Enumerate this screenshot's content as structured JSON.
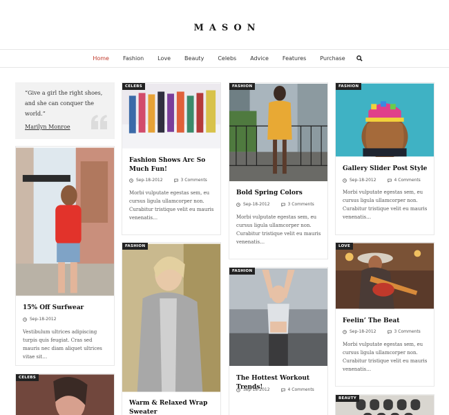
{
  "site": {
    "logo": "MASON"
  },
  "nav": {
    "items": [
      "Home",
      "Fashion",
      "Love",
      "Beauty",
      "Celebs",
      "Advice",
      "Features",
      "Purchase"
    ],
    "active": "Home"
  },
  "quote": {
    "text": "“Give a girl the right shoes, and she can conquer the world.”",
    "author": "Marilyn Monroe"
  },
  "posts": [
    {
      "title": "15% Off Surfwear",
      "date": "Sep-18-2012",
      "comments": "",
      "excerpt": "Vestibulum ultrices adipiscing turpis quis feugiat. Cras sed mauris nec diam aliquet ultrices vitae sit…",
      "tag": ""
    },
    {
      "title": "",
      "date": "",
      "comments": "",
      "excerpt": "",
      "tag": "CELEBS"
    },
    {
      "title": "Fashion Shows Arc So Much Fun!",
      "date": "Sep-18-2012",
      "comments": "3 Comments",
      "excerpt": "Morbi vulputate egestas sem, eu cursus ligula ullamcorper non. Curabitur tristique velit eu mauris venenatis…",
      "tag": "CELEBS"
    },
    {
      "title": "Warm & Relaxed Wrap Sweater",
      "date": "",
      "comments": "",
      "excerpt": "",
      "tag": "FASHION"
    },
    {
      "title": "Bold Spring Colors",
      "date": "Sep-18-2012",
      "comments": "3 Comments",
      "excerpt": "Morbi vulputate egestas sem, eu cursus ligula ullamcorper non. Curabitur tristique velit eu mauris venenatis…",
      "tag": "FASHION"
    },
    {
      "title": "The Hottest Workout Trends!",
      "date": "Sep-18-2012",
      "comments": "4 Comments",
      "excerpt": "",
      "tag": "FASHION"
    },
    {
      "title": "Gallery Slider Post Style",
      "date": "Sep-18-2012",
      "comments": "4 Comments",
      "excerpt": "Morbi vulputate egestas sem, eu cursus ligula ullamcorper non. Curabitur tristique velit eu mauris venenatis…",
      "tag": "FASHION"
    },
    {
      "title": "Feelin’ The Beat",
      "date": "Sep-18-2012",
      "comments": "3 Comments",
      "excerpt": "Morbi vulputate egestas sem, eu cursus ligula ullamcorper non. Curabitur tristique velit eu mauris venenatis…",
      "tag": "LOVE"
    },
    {
      "title": "",
      "date": "",
      "comments": "",
      "excerpt": "",
      "tag": "BEAUTY"
    }
  ],
  "icons": {
    "search": "search-icon",
    "clock": "clock-icon",
    "comment": "comment-icon",
    "quote": "quote-mark-icon"
  },
  "colors": {
    "accent": "#c0392b",
    "tag_bg": "#222222",
    "quote_bg": "#f2f2f2"
  }
}
